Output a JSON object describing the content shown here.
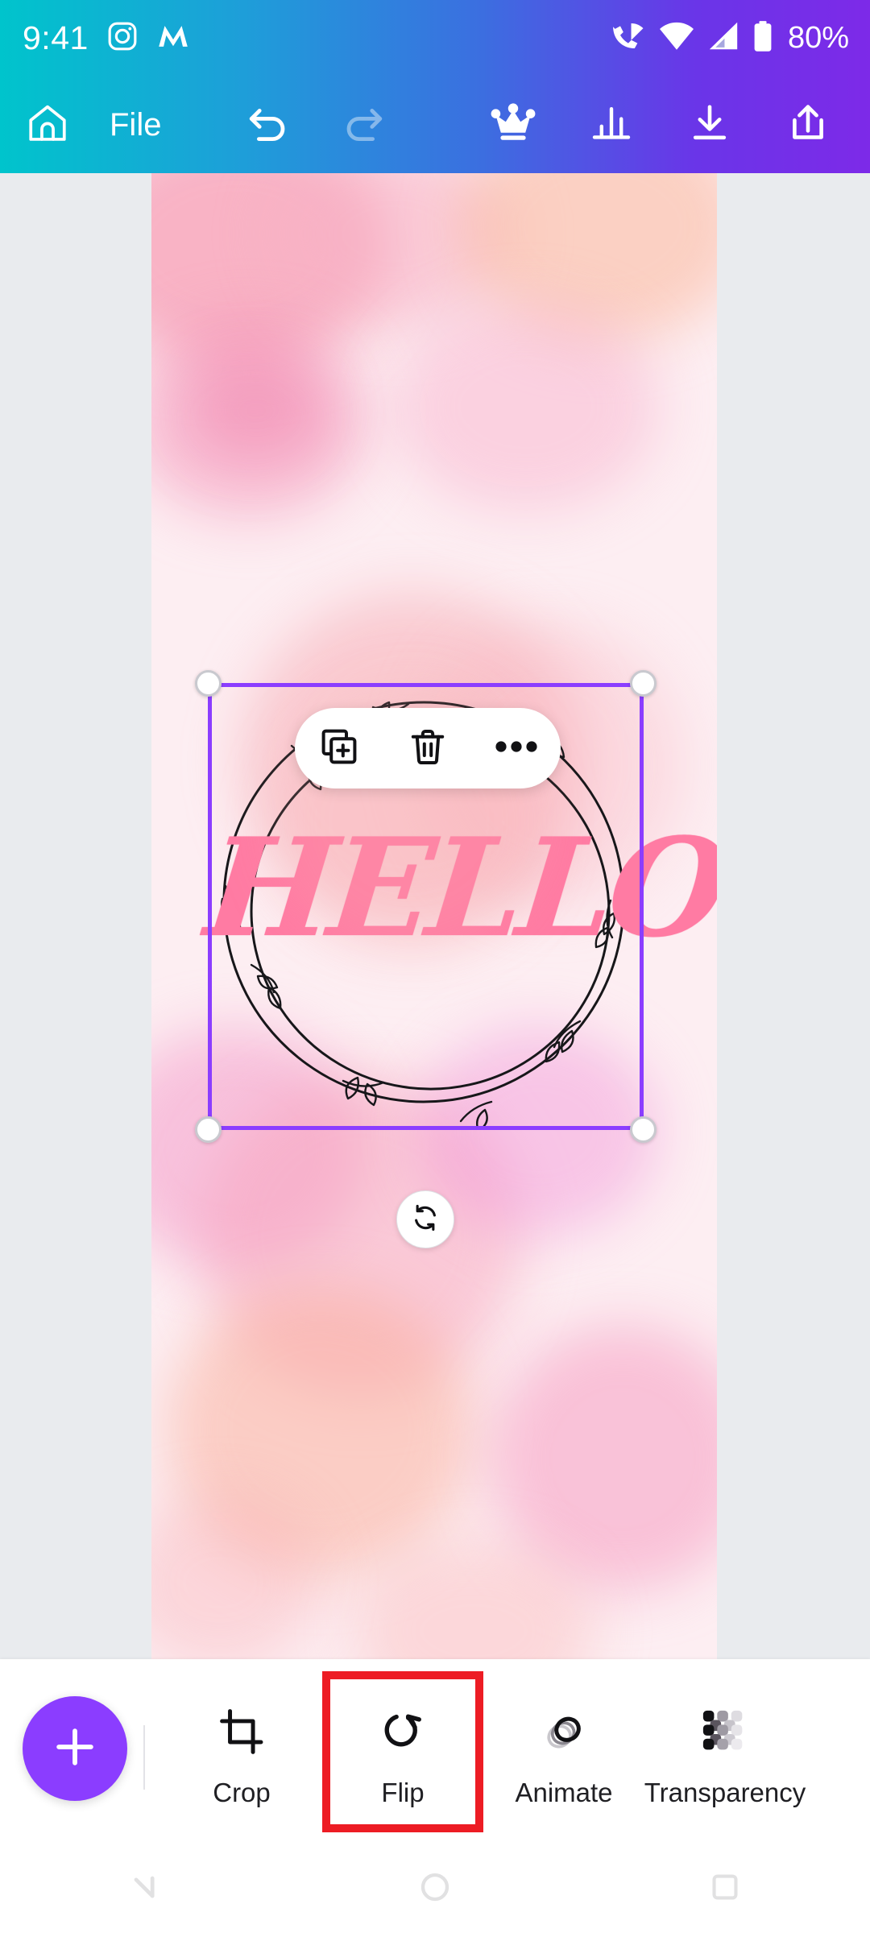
{
  "status_bar": {
    "time": "9:41",
    "battery_percent": "80%",
    "icons": [
      "instagram-icon",
      "messenger-m-icon",
      "call-wifi-icon",
      "wifi-icon",
      "cellular-signal-icon",
      "battery-icon"
    ]
  },
  "app_toolbar": {
    "home_label": "Home",
    "file_label": "File",
    "undo_label": "Undo",
    "redo_label": "Redo",
    "redo_enabled": false,
    "crown_label": "Premium",
    "insights_label": "Insights",
    "download_label": "Download",
    "share_label": "Share",
    "gradient_start": "#00c4cc",
    "gradient_end": "#7d2ae8"
  },
  "canvas": {
    "page_background": "#fdeef2",
    "workspace_background": "#e9ebee",
    "element_text": "HELLO",
    "element_text_color": "#ff7ba3",
    "element_name": "floral-wreath-hello-graphic",
    "selection_color": "#8b3dff"
  },
  "context_menu": {
    "duplicate_label": "Duplicate",
    "delete_label": "Delete",
    "more_label": "More options"
  },
  "selection": {
    "rotate_label": "Rotate"
  },
  "bottom_toolbar": {
    "add_label": "Add",
    "highlight_color": "#ed1c24",
    "fab_color": "#8b3dff",
    "tools": [
      {
        "label": "Crop",
        "icon": "crop-icon",
        "highlighted": false
      },
      {
        "label": "Flip",
        "icon": "flip-icon",
        "highlighted": true
      },
      {
        "label": "Animate",
        "icon": "animate-icon",
        "highlighted": false
      },
      {
        "label": "Transparency",
        "icon": "transparency-icon",
        "highlighted": false
      }
    ]
  },
  "nav_bar": {
    "back_label": "Back",
    "home_label": "Home",
    "recents_label": "Recents"
  }
}
